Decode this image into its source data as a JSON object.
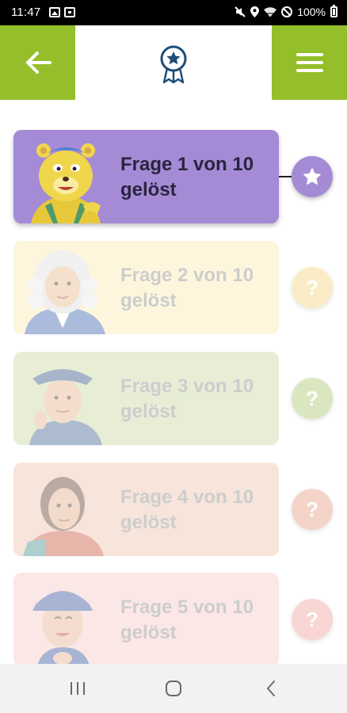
{
  "status_bar": {
    "time": "11:47",
    "battery_text": "100%",
    "icons": [
      "image-notification-icon",
      "document-notification-icon",
      "mute-icon",
      "location-icon",
      "wifi-icon",
      "do-not-disturb-icon",
      "battery-icon"
    ]
  },
  "header": {
    "back_icon": "arrow-left-icon",
    "logo_icon": "award-ribbon-icon",
    "menu_icon": "hamburger-menu-icon",
    "accent_color": "#95bf2a",
    "logo_color": "#1f4e79"
  },
  "quiz_items": [
    {
      "line1": "Frage 1 von 10",
      "line2": "gelöst",
      "status": "solved",
      "badge_icon": "star-icon",
      "card_color": "#a58bd6",
      "badge_color": "#a58bd6",
      "text_color": "#2a2440",
      "character": "yellow-cat-character"
    },
    {
      "line1": "Frage 2 von 10",
      "line2": "gelöst",
      "status": "locked",
      "badge_label": "?",
      "badge_icon": "question-mark-icon",
      "card_color": "#fbeab0",
      "badge_color": "#f5d47a",
      "character": "powdered-wig-character"
    },
    {
      "line1": "Frage 3 von 10",
      "line2": "gelöst",
      "status": "locked",
      "badge_label": "?",
      "badge_icon": "question-mark-icon",
      "card_color": "#c7d99c",
      "badge_color": "#a8c56a",
      "character": "tricorn-hat-character"
    },
    {
      "line1": "Frage 4 von 10",
      "line2": "gelöst",
      "status": "locked",
      "badge_label": "?",
      "badge_icon": "question-mark-icon",
      "card_color": "#edbfa8",
      "badge_color": "#e59a80",
      "character": "long-hair-character"
    },
    {
      "line1": "Frage 5 von 10",
      "line2": "gelöst",
      "status": "locked",
      "badge_label": "?",
      "badge_icon": "question-mark-icon",
      "card_color": "#f7c8c4",
      "badge_color": "#f0a09a",
      "character": "cap-character"
    }
  ],
  "nav_bar": {
    "buttons": [
      "recent-apps-icon",
      "home-icon",
      "back-chevron-icon"
    ]
  }
}
